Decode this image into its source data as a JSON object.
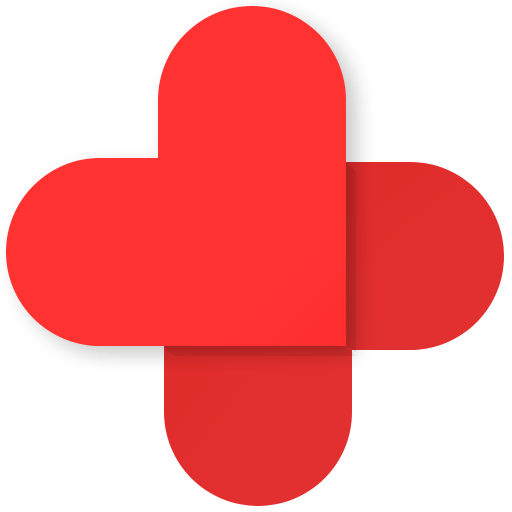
{
  "logo": {
    "icon": "heart-cross-icon",
    "colors": {
      "primary_red": "#FF3333",
      "secondary_red": "#E02A2A",
      "background": "#FFFFFF"
    }
  }
}
